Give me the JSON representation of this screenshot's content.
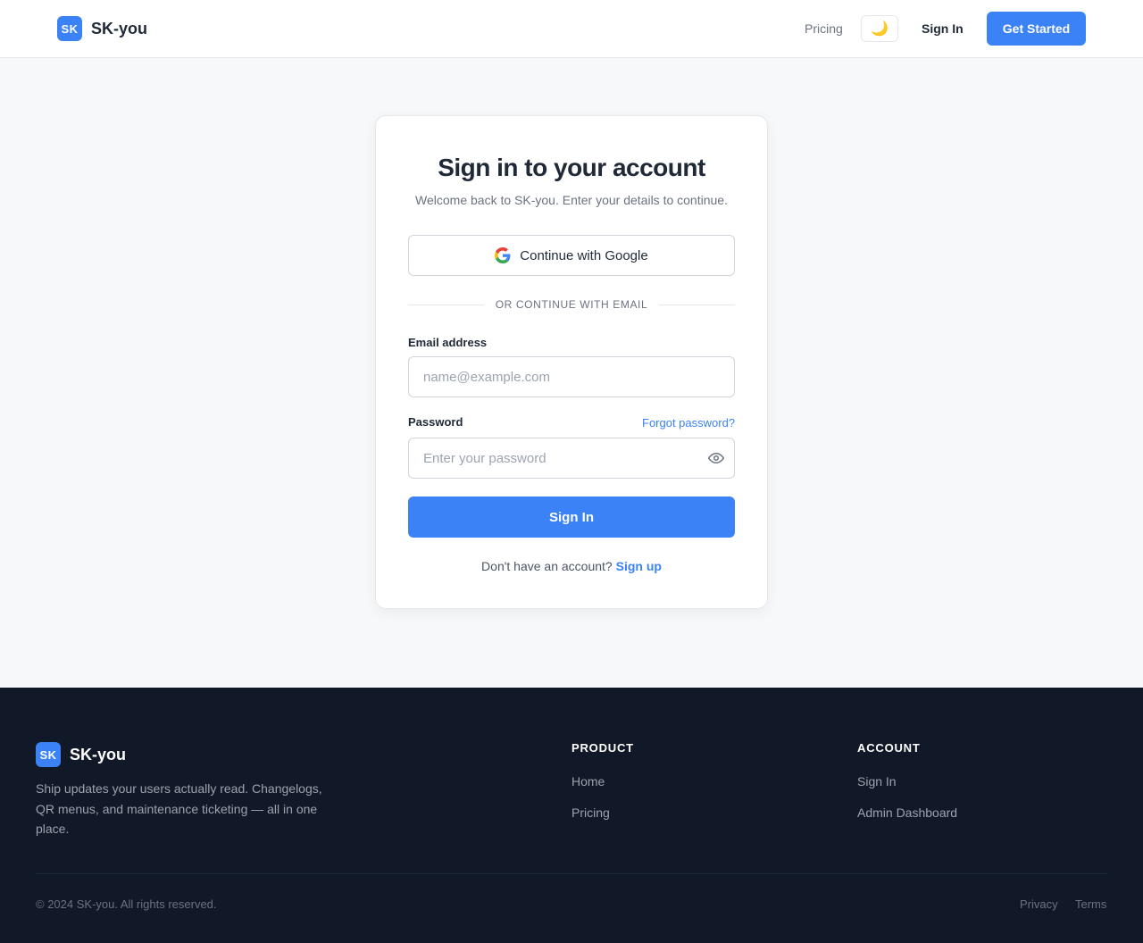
{
  "header": {
    "logo_text": "SK",
    "brand": "SK-you",
    "nav_pricing": "Pricing",
    "theme_toggle_icon": "moon-icon",
    "sign_in": "Sign In",
    "get_started": "Get Started"
  },
  "card": {
    "title": "Sign in to your account",
    "subtitle": "Welcome back to SK-you. Enter your details to continue.",
    "google_button": "Continue with Google",
    "divider": "OR CONTINUE WITH EMAIL",
    "email_label": "Email address",
    "email_placeholder": "name@example.com",
    "password_label": "Password",
    "forgot_password": "Forgot password?",
    "password_placeholder": "Enter your password",
    "submit": "Sign In",
    "no_account": "Don't have an account?",
    "sign_up": "Sign up"
  },
  "footer": {
    "logo_text": "SK",
    "brand": "SK-you",
    "description": "Ship updates your users actually read. Changelogs, QR menus, and maintenance ticketing — all in one place.",
    "product_title": "PRODUCT",
    "product_links": [
      "Home",
      "Pricing"
    ],
    "account_title": "ACCOUNT",
    "account_links": [
      "Sign In",
      "Admin Dashboard"
    ],
    "copyright": "© 2024 SK-you. All rights reserved.",
    "privacy": "Privacy",
    "terms": "Terms"
  },
  "colors": {
    "accent": "#3b82f6",
    "footer_bg": "#111827",
    "page_bg": "#f7f8fa"
  }
}
